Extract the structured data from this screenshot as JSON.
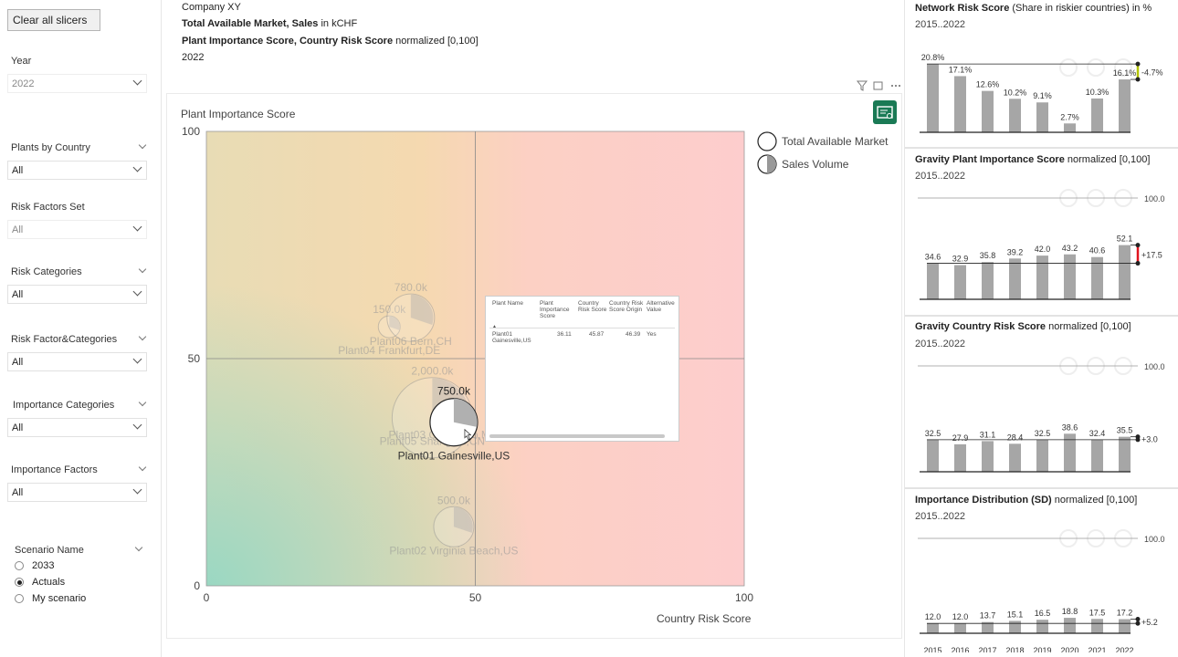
{
  "slicers": {
    "clear_label": "Clear all slicers",
    "year": {
      "title": "Year",
      "value": "2022"
    },
    "plants_by_country": {
      "title": "Plants by Country",
      "value": "All"
    },
    "risk_factors_set": {
      "title": "Risk Factors Set",
      "value": "All"
    },
    "risk_categories": {
      "title": "Risk Categories",
      "value": "All"
    },
    "risk_factor_categories": {
      "title": "Risk Factor&Categories",
      "value": "All"
    },
    "importance_categories": {
      "title": "Importance Categories",
      "value": "All"
    },
    "importance_factors": {
      "title": "Importance Factors",
      "value": "All"
    },
    "scenario": {
      "title": "Scenario Name",
      "options": [
        "2033",
        "Actuals",
        "My scenario"
      ],
      "selected": "Actuals"
    }
  },
  "header": {
    "company": "Company XY",
    "line2_bold": "Total Available Market, Sales",
    "line2_rest": " in kCHF",
    "line3_bold": "Plant Importance Score, Country Risk Score",
    "line3_rest": " normalized [0,100]",
    "year": "2022"
  },
  "main_chart": {
    "ylabel": "Plant Importance Score",
    "xlabel": "Country Risk Score",
    "legend": [
      "Total Available Market",
      "Sales Volume"
    ],
    "chart_data": {
      "type": "scatter",
      "xlim": [
        0,
        100
      ],
      "ylim": [
        0,
        100
      ],
      "x_ticks": [
        "0",
        "50",
        "100"
      ],
      "y_ticks": [
        "0",
        "50",
        "100"
      ],
      "points": [
        {
          "name": "Plant01 Gainesville,US",
          "x": 46,
          "y": 36,
          "tam": "750.0k",
          "highlighted": true
        },
        {
          "name": "Plant04 Frankfurt,DE",
          "x": 34,
          "y": 57,
          "tam": "150.0k"
        },
        {
          "name": "Plant06 Bern,CH",
          "x": 38,
          "y": 59,
          "tam": "780.0k"
        },
        {
          "name": "Plant05 Shanghai,CN",
          "x": 42,
          "y": 37,
          "tam": "2,000.0k",
          "sales_label": "150"
        },
        {
          "name": "Plant03 Queretaro,MX",
          "x": 44,
          "y": 36,
          "tam": ""
        },
        {
          "name": "Plant02 Virginia Beach,US",
          "x": 46,
          "y": 13,
          "tam": "500.0k"
        }
      ]
    }
  },
  "tooltip": {
    "headers": [
      "Plant Name",
      "Plant Importance Score",
      "Country Risk Score",
      "Country Risk Score Origin",
      "Alternative Value"
    ],
    "row": [
      "Plant01 Gainesville,US",
      "36.11",
      "45.87",
      "46.39",
      "Yes"
    ]
  },
  "panels": [
    {
      "title_bold": "Network Risk Score",
      "title_rest": " (Share in riskier countries) in %",
      "subtitle": "2015..2022",
      "chart_data": {
        "type": "bar",
        "categories": [
          "2015",
          "2016",
          "2017",
          "2018",
          "2019",
          "2020",
          "2021",
          "2022"
        ],
        "values": [
          20.8,
          17.1,
          12.6,
          10.2,
          9.1,
          2.7,
          10.3,
          16.1
        ],
        "labels": [
          "20.8%",
          "17.1%",
          "12.6%",
          "10.2%",
          "9.1%",
          "2.7%",
          "10.3%",
          "16.1%"
        ],
        "delta": "-4.7%",
        "delta_color": "#b5c400"
      }
    },
    {
      "title_bold": "Gravity Plant Importance Score",
      "title_rest": " normalized [0,100]",
      "subtitle": "2015..2022",
      "ref_label": "100.0",
      "chart_data": {
        "type": "bar",
        "categories": [
          "2015",
          "2016",
          "2017",
          "2018",
          "2019",
          "2020",
          "2021",
          "2022"
        ],
        "values": [
          34.6,
          32.9,
          35.8,
          39.2,
          42.0,
          43.2,
          40.6,
          52.1
        ],
        "labels": [
          "34.6",
          "32.9",
          "35.8",
          "39.2",
          "42.0",
          "43.2",
          "40.6",
          "52.1"
        ],
        "delta": "+17.5",
        "delta_color": "#e0141e"
      }
    },
    {
      "title_bold": "Gravity Country Risk Score",
      "title_rest": " normalized [0,100]",
      "subtitle": "2015..2022",
      "ref_label": "100.0",
      "chart_data": {
        "type": "bar",
        "categories": [
          "2015",
          "2016",
          "2017",
          "2018",
          "2019",
          "2020",
          "2021",
          "2022"
        ],
        "values": [
          32.5,
          27.9,
          31.1,
          28.4,
          32.5,
          38.6,
          32.4,
          35.5
        ],
        "labels": [
          "32.5",
          "27.9",
          "31.1",
          "28.4",
          "32.5",
          "38.6",
          "32.4",
          "35.5"
        ],
        "delta": "+3.0",
        "delta_color": "#222222"
      }
    },
    {
      "title_bold": "Importance Distribution (SD)",
      "title_rest": " normalized [0,100]",
      "subtitle": "2015..2022",
      "ref_label": "100.0",
      "chart_data": {
        "type": "bar",
        "categories": [
          "2015",
          "2016",
          "2017",
          "2018",
          "2019",
          "2020",
          "2021",
          "2022"
        ],
        "values": [
          12.0,
          12.0,
          13.7,
          15.1,
          16.5,
          18.8,
          17.5,
          17.2
        ],
        "labels": [
          "12.0",
          "12.0",
          "13.7",
          "15.1",
          "16.5",
          "18.8",
          "17.5",
          "17.2"
        ],
        "delta": "+5.2",
        "delta_color": "#222222",
        "show_categories": true
      }
    }
  ],
  "colors": {
    "bar": "#a6a6a6",
    "accent": "#1f7a5a"
  }
}
